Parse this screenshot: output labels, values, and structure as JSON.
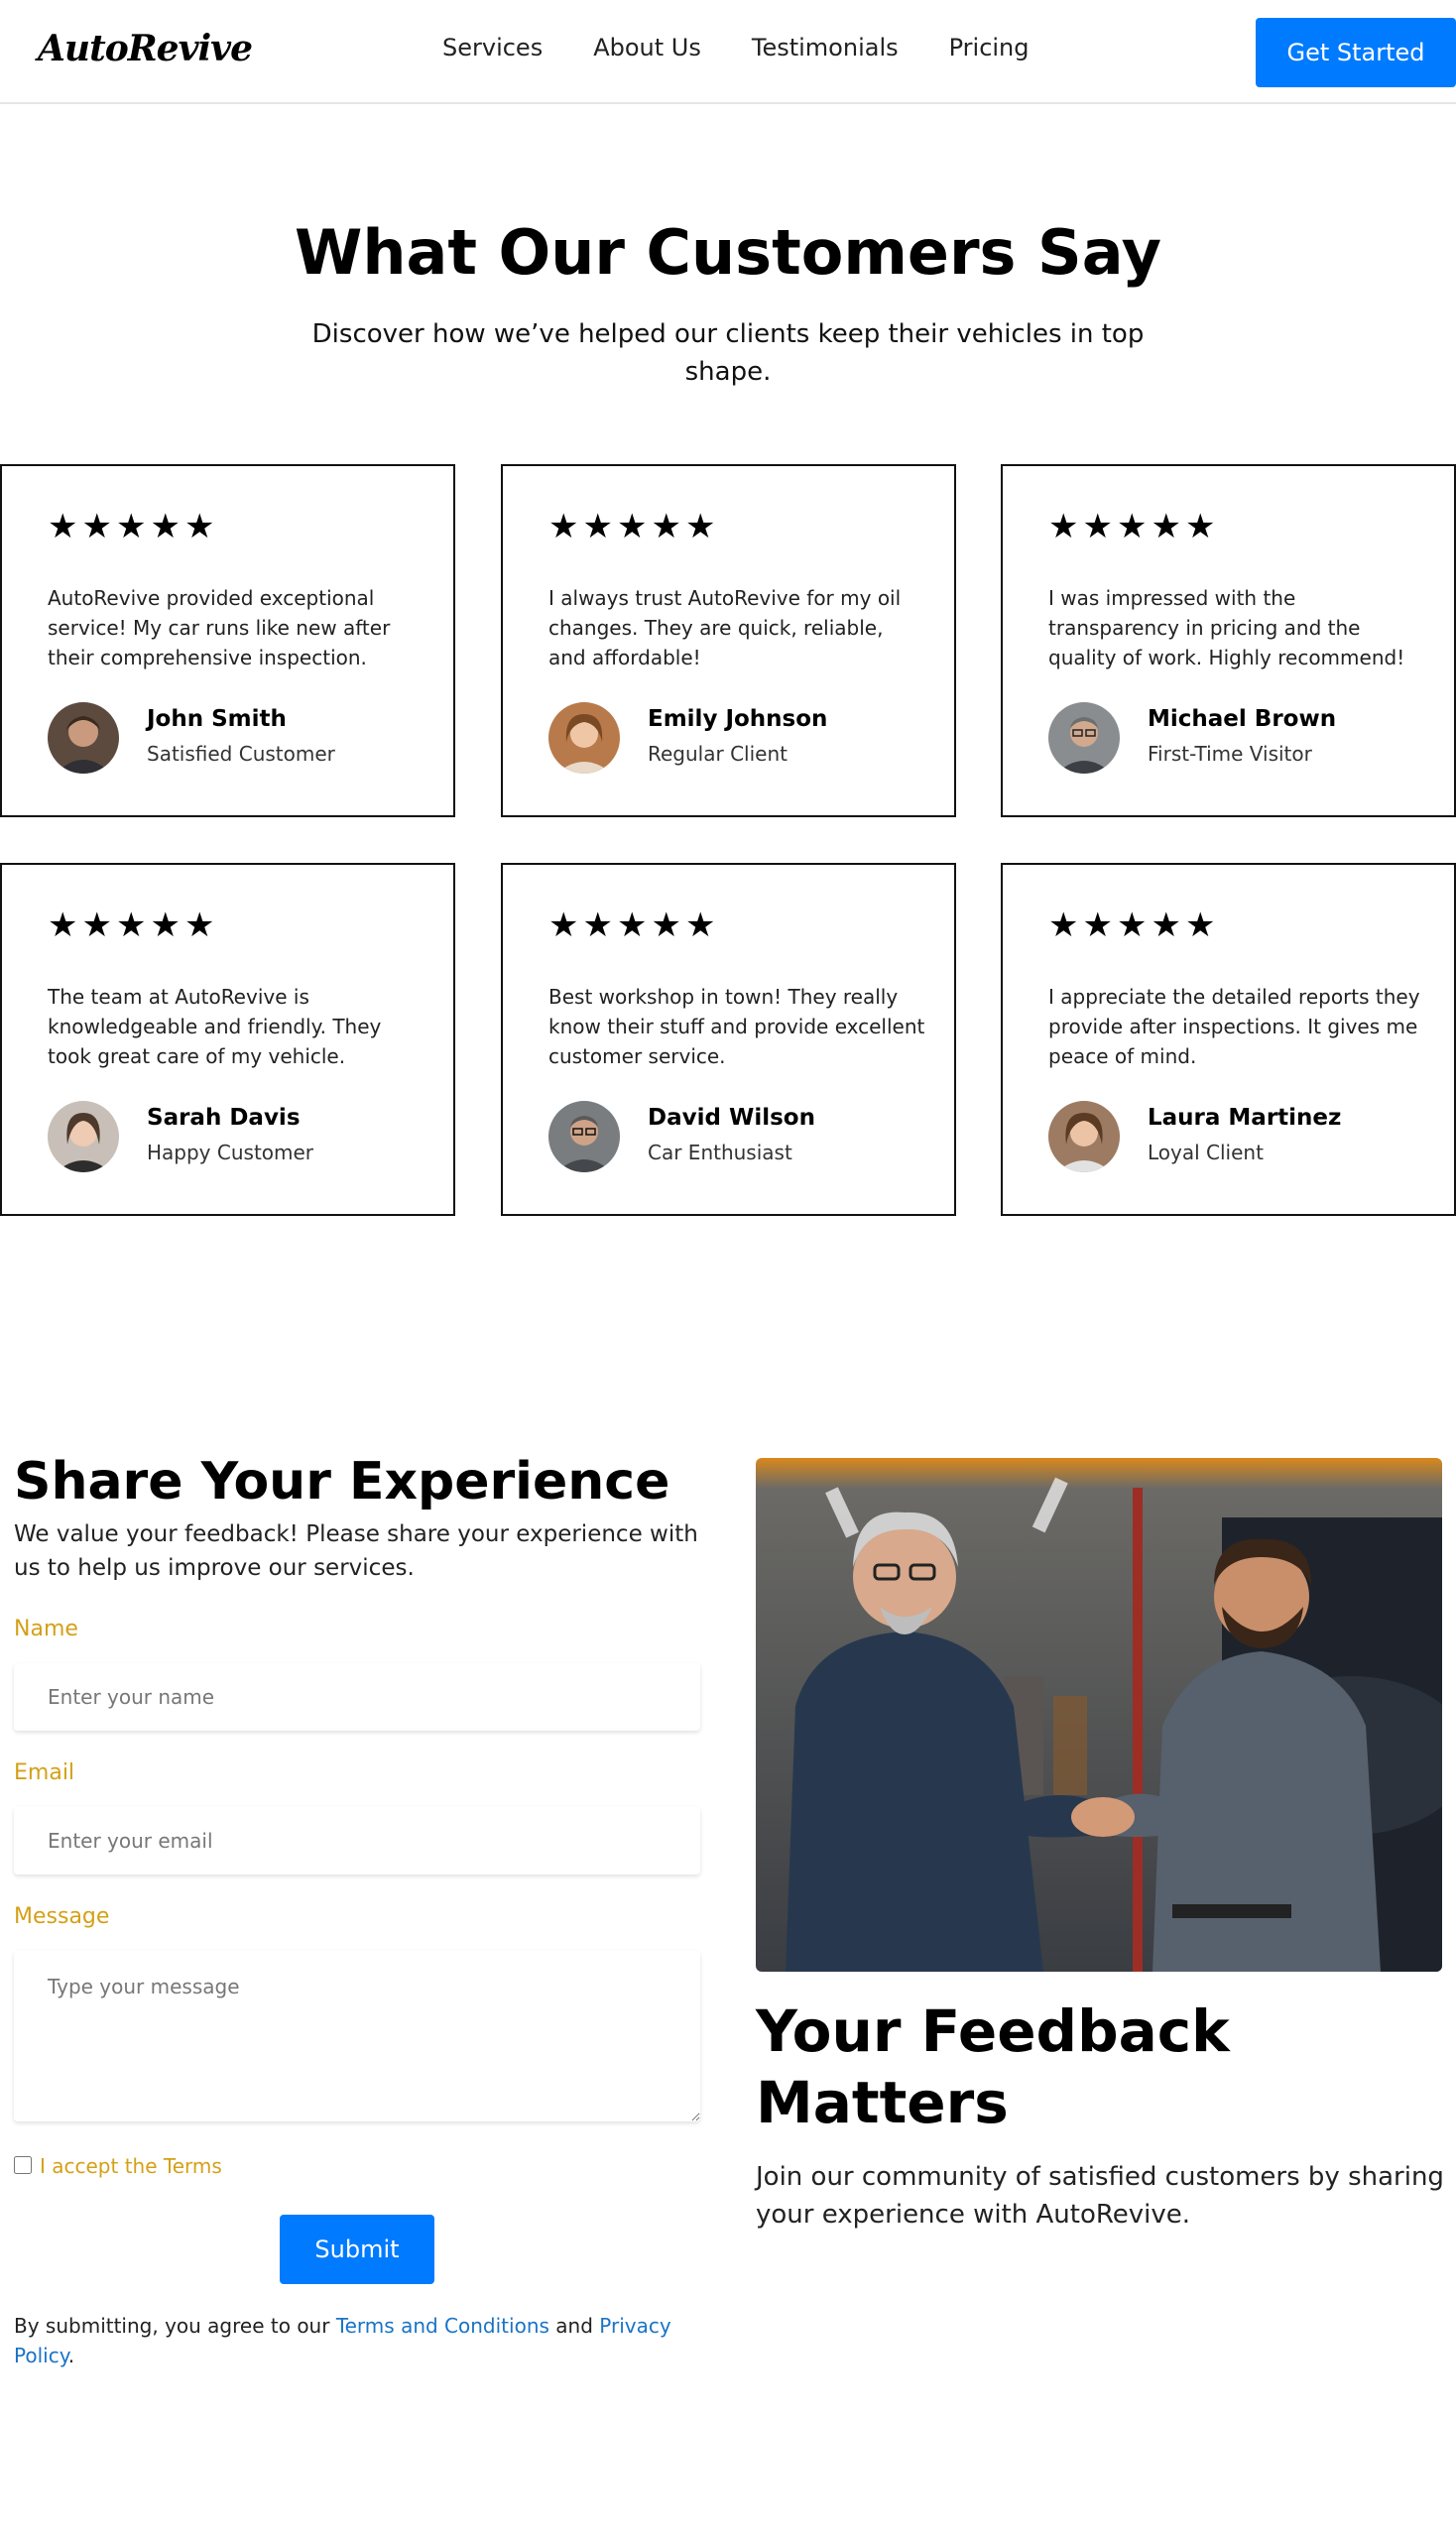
{
  "nav": {
    "logo": "AutoRevive",
    "links": [
      "Services",
      "About Us",
      "Testimonials",
      "Pricing"
    ],
    "cta": "Get Started"
  },
  "hero": {
    "title": "What Our Customers Say",
    "subtitle": "Discover how we’ve helped our clients keep their vehicles in top shape."
  },
  "testimonials": [
    {
      "stars": "★★★★★",
      "rating": 5,
      "quote": "AutoRevive provided exceptional service! My car runs like new after their comprehensive inspection.",
      "name": "John Smith",
      "role": "Satisfied Customer"
    },
    {
      "stars": "★★★★★",
      "rating": 5,
      "quote": "I always trust AutoRevive for my oil changes. They are quick, reliable, and affordable!",
      "name": "Emily Johnson",
      "role": "Regular Client"
    },
    {
      "stars": "★★★★★",
      "rating": 5,
      "quote": "I was impressed with the transparency in pricing and the quality of work. Highly recommend!",
      "name": "Michael Brown",
      "role": "First-Time Visitor"
    },
    {
      "stars": "★★★★★",
      "rating": 5,
      "quote": "The team at AutoRevive is knowledgeable and friendly. They took great care of my vehicle.",
      "name": "Sarah Davis",
      "role": "Happy Customer"
    },
    {
      "stars": "★★★★★",
      "rating": 5,
      "quote": "Best workshop in town! They really know their stuff and provide excellent customer service.",
      "name": "David Wilson",
      "role": "Car Enthusiast"
    },
    {
      "stars": "★★★★★",
      "rating": 5,
      "quote": "I appreciate the detailed reports they provide after inspections. It gives me peace of mind.",
      "name": "Laura Martinez",
      "role": "Loyal Client"
    }
  ],
  "form": {
    "title": "Share Your Experience",
    "description": "We value your feedback! Please share your experience with us to help us improve our services.",
    "name_label": "Name",
    "name_placeholder": "Enter your name",
    "email_label": "Email",
    "email_placeholder": "Enter your email",
    "message_label": "Message",
    "message_placeholder": "Type your message",
    "terms_label": "I accept the Terms",
    "submit": "Submit",
    "legal_prefix": "By submitting, you agree to our ",
    "terms_link": "Terms and Conditions",
    "legal_and": " and ",
    "privacy_link": "Privacy Policy",
    "legal_suffix": "."
  },
  "feedback": {
    "title": "Your Feedback Matters",
    "description": "Join our community of satisfied customers by sharing your experience with AutoRevive."
  },
  "colors": {
    "accent": "#007bff",
    "label": "#d4a017",
    "link": "#1a73c8"
  }
}
